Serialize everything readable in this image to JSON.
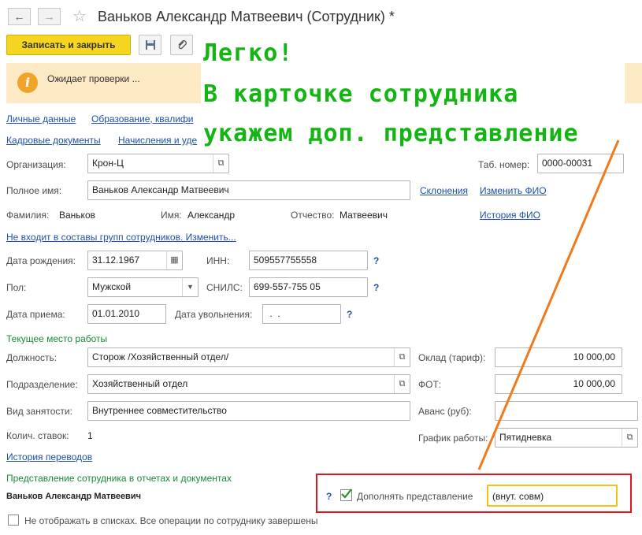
{
  "window": {
    "title": "Ваньков Александр Матвеевич (Сотрудник) *"
  },
  "toolbar": {
    "save_close_label": "Записать и закрыть"
  },
  "notice": {
    "text": "Ожидает проверки ..."
  },
  "overlay": {
    "line1": "Легко!",
    "line2": "В карточке сотрудника",
    "line3": "укажем доп. представление"
  },
  "tabs": {
    "personal": "Личные данные",
    "education": "Образование, квалифи",
    "hr_docs": "Кадровые документы",
    "accruals": "Начисления и уде"
  },
  "form": {
    "org_label": "Организация:",
    "org_value": "Крон-Ц",
    "tab_num_label": "Таб. номер:",
    "tab_num_value": "0000-00031",
    "full_name_label": "Полное имя:",
    "full_name_value": "Ваньков Александр Матвеевич",
    "declension_link": "Склонения",
    "change_fio_link": "Изменить ФИО",
    "surname_label": "Фамилия:",
    "surname_value": "Ваньков",
    "name_label": "Имя:",
    "name_value": "Александр",
    "patronymic_label": "Отчество:",
    "patronymic_value": "Матвеевич",
    "fio_history_link": "История ФИО",
    "groups_link": "Не входит в составы групп сотрудников. Изменить...",
    "birth_label": "Дата рождения:",
    "birth_value": "31.12.1967",
    "inn_label": "ИНН:",
    "inn_value": "509557755558",
    "gender_label": "Пол:",
    "gender_value": "Мужской",
    "snils_label": "СНИЛС:",
    "snils_value": "699-557-755 05",
    "hire_label": "Дата приема:",
    "hire_value": "01.01.2010",
    "fire_label": "Дата увольнения:",
    "fire_value": " .  .",
    "question": "?",
    "current_work_section": "Текущее место работы",
    "position_label": "Должность:",
    "position_value": "Сторож /Хозяйственный отдел/",
    "salary_label": "Оклад (тариф):",
    "salary_value": "10 000,00",
    "department_label": "Подразделение:",
    "department_value": "Хозяйственный отдел",
    "fot_label": "ФОТ:",
    "fot_value": "10 000,00",
    "employment_label": "Вид занятости:",
    "employment_value": "Внутреннее совместительство",
    "advance_label": "Аванс (руб):",
    "advance_value": "",
    "rates_label": "Колич. ставок:",
    "rates_value": "1",
    "schedule_label": "График работы:",
    "schedule_value": "Пятидневка",
    "transfer_history_link": "История переводов",
    "representation_section": "Представление сотрудника в отчетах и документах",
    "representation_name": "Ваньков Александр Матвеевич",
    "supplement_label": "Дополнять представление",
    "supplement_value": "(внут. совм)",
    "hide_label": "Не отображать в списках. Все операции по сотруднику завершены"
  },
  "colors": {
    "save_button": "#f5d51f",
    "notice_bg": "#fde9c4",
    "highlight_border": "#e0161f",
    "overlay_text": "#13b513",
    "arrow": "#f07a1e",
    "section_green": "#1a8a3a"
  }
}
